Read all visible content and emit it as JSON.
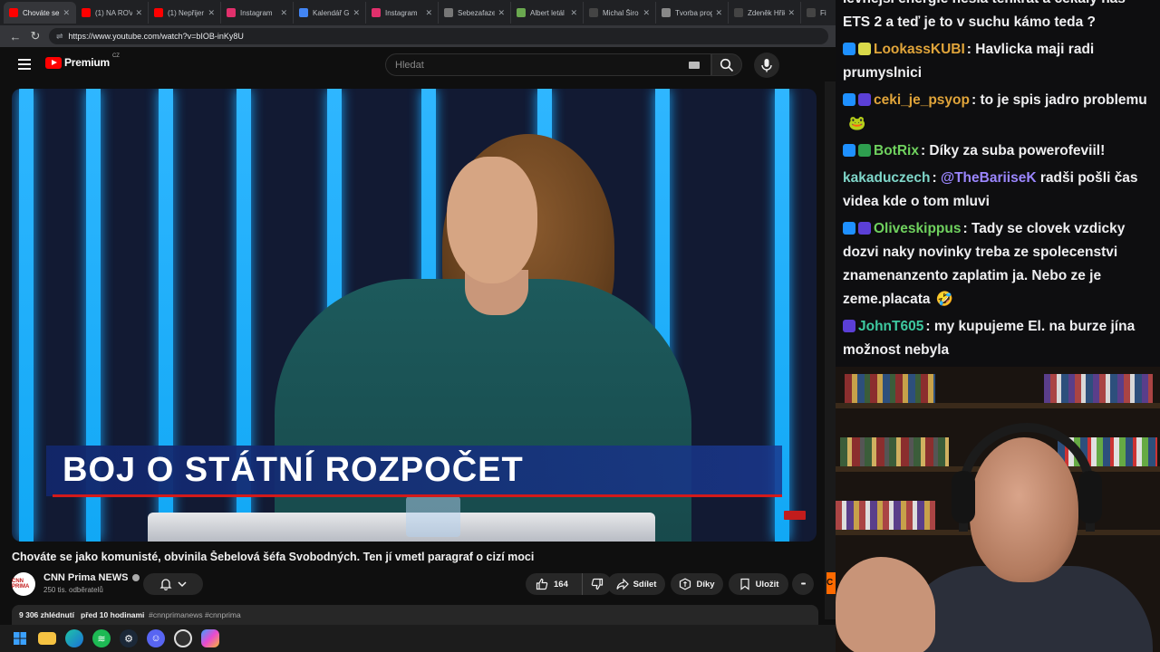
{
  "browser": {
    "tabs": [
      {
        "label": "Chováte se",
        "color": "#ff0000",
        "active": true
      },
      {
        "label": "(1) NA ROV",
        "color": "#ff0000",
        "active": false
      },
      {
        "label": "(1) Nepřijer",
        "color": "#ff0000",
        "active": false
      },
      {
        "label": "Instagram",
        "color": "#e1306c",
        "active": false
      },
      {
        "label": "Kalendář G",
        "color": "#4285f4",
        "active": false
      },
      {
        "label": "Instagram",
        "color": "#e1306c",
        "active": false
      },
      {
        "label": "Sebezafaze",
        "color": "#777777",
        "active": false
      },
      {
        "label": "Albert letál",
        "color": "#6aa84f",
        "active": false
      },
      {
        "label": "Michal Širo",
        "color": "#444444",
        "active": false
      },
      {
        "label": "Tvorba prog",
        "color": "#888888",
        "active": false
      },
      {
        "label": "Zdeněk Hřik",
        "color": "#444444",
        "active": false
      },
      {
        "label": "Fi",
        "color": "#444444",
        "active": false
      }
    ],
    "tab_close": "✕",
    "back": "←",
    "reload": "↻",
    "url": "https://www.youtube.com/watch?v=bIOB-inKy8U"
  },
  "youtube": {
    "brand": "Premium",
    "region": "CZ",
    "search_placeholder": "Hledat",
    "video_overlay_text": "BOJ O STÁTNÍ ROZPOČET",
    "video_title": "Chováte se jako komunisté, obvinila Šebelová šéfa Svobodných. Ten jí vmetl paragraf o cizí moci",
    "channel": {
      "name": "CNN Prima NEWS",
      "subscribers": "250 tis. odběratelů",
      "avatar_text": "CNN PRIMA"
    },
    "actions": {
      "like_count": "164",
      "share": "Sdílet",
      "thanks": "Díky",
      "save": "Uložit",
      "more": "•••"
    },
    "description": {
      "views": "9 306 zhlédnutí",
      "age": "před 10 hodinami",
      "tags": "#cnnprimanews #cnnprima"
    }
  },
  "chat": {
    "messages": [
      {
        "user": "",
        "text": "levnější energie nesla tenkrát a cekaly nas ETS 2 a teď je to v suchu kámo teda ?",
        "color": "#efeff1",
        "badges": []
      },
      {
        "user": "LookassKUBI",
        "text": "Havlicka maji radi prumyslnici",
        "color": "#e0a43a",
        "badges": [
          "#1e90ff",
          "#d9d94a"
        ]
      },
      {
        "user": "ceki_je_psyop",
        "text": "to je spis jadro problemu",
        "color": "#e0a43a",
        "badges": [
          "#1e90ff",
          "#5b3fd6"
        ],
        "emote": "🐸"
      },
      {
        "user": "BotRix",
        "text": "Díky za suba powerofeviil!",
        "color": "#6fd15e",
        "badges": [
          "#1e90ff",
          "#2e9e4f"
        ]
      },
      {
        "user": "kakaduczech",
        "mention": "@TheBariiseK",
        "text": "radši pošli čas videa kde o tom mluvi",
        "color": "#7fd6c9",
        "badges": []
      },
      {
        "user": "Oliveskippus",
        "text": "Tady se clovek vzdicky dozvi naky novinky treba ze spolecenstvi znamenanzento zaplatim ja. Nebo ze je zeme.placata",
        "color": "#6fd15e",
        "badges": [
          "#1e90ff",
          "#5b3fd6"
        ],
        "emote": "🤣"
      },
      {
        "user": "JohnT605",
        "text": "my kupujeme El. na burze jína možnost nebyla",
        "color": "#3ec9a0",
        "badges": [
          "#5b3fd6"
        ]
      }
    ]
  },
  "taskbar": {
    "icons": [
      "windows-start",
      "file-explorer",
      "edge",
      "spotify",
      "steam",
      "discord",
      "obs",
      "copilot"
    ]
  },
  "colors": {
    "yt_red": "#ff0000",
    "bg": "#0f0f0f",
    "chip": "#272727",
    "overlay_blue": "#12266a",
    "overlay_red": "#d31a1a"
  }
}
